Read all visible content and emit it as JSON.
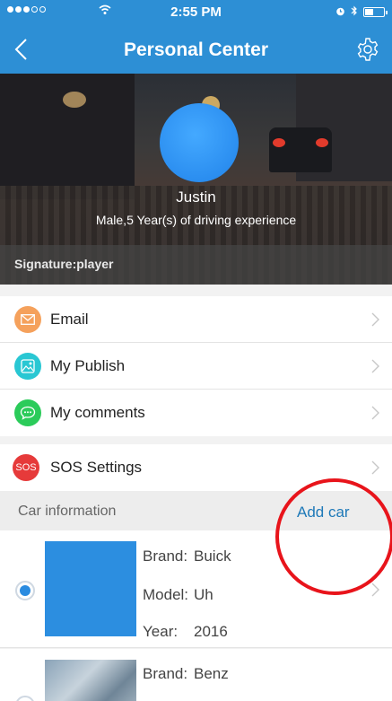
{
  "status_bar": {
    "time": "2:55 PM"
  },
  "nav": {
    "title": "Personal Center"
  },
  "profile": {
    "name": "Justin",
    "experience": "Male,5 Year(s) of driving experience",
    "signature": "Signature:player",
    "avatar_color": "#2b8ef0"
  },
  "menu": [
    {
      "label": "Email",
      "icon": "envelope-icon",
      "color": "#f5a15c"
    },
    {
      "label": "My Publish",
      "icon": "image-icon",
      "color": "#29c7d3"
    },
    {
      "label": "My comments",
      "icon": "chat-bubble-icon",
      "color": "#2bcb5a"
    }
  ],
  "sos": {
    "label": "SOS Settings",
    "icon_text": "SOS",
    "color": "#e63a3a"
  },
  "car_section": {
    "label": "Car information",
    "add_label": "Add car",
    "accent": "#1e79b8"
  },
  "cars": [
    {
      "brand_label": "Brand:",
      "brand": "Buick",
      "model_label": "Model:",
      "model": "Uh",
      "year_label": "Year:",
      "year": "2016",
      "selected": true
    },
    {
      "brand_label": "Brand:",
      "brand": "Benz"
    }
  ],
  "colors": {
    "header": "#2d8fd5",
    "annotation": "#e8141b"
  }
}
